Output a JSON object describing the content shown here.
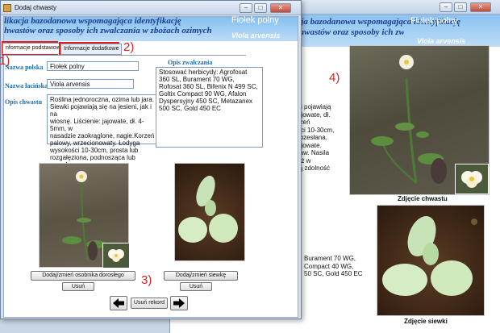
{
  "back_window": {
    "header_line1": "likacja bazodanowa wspomagająca identyfikację",
    "header_line2": "hwastów oraz sposoby ich zwalczania w zbożach ozimych",
    "species_name": "Fiołek polny",
    "latin_name": "Viola arvensis",
    "desc_lines": [
      "ki pojawiają",
      "ajowate, dł.",
      "rzeń",
      "ści 10-30cm,",
      "rozesłana.",
      "ajowate.",
      "raw. Nasila",
      "óż w",
      "ją zdolność"
    ],
    "herb_lines": [
      "Burament 70 WG,",
      "Compact 40 WG,",
      "50 SC, Gold 450 EC"
    ],
    "weed_photo_caption": "Zdjęcie chwastu",
    "seedling_photo_caption": "Zdjęcie  siewki"
  },
  "front_window": {
    "title": "Dodaj chwasty",
    "header_line1": "likacja bazodanowa wspomagająca identyfikację",
    "header_line2": "hwastów oraz sposoby ich zwalczania w zbożach ozimych",
    "species_name": "Fiołek polny",
    "latin_name": "Viola arvensis",
    "tabs": [
      {
        "label": "nformacje podstawowe",
        "active": true
      },
      {
        "label": "Informacje dodatkowe",
        "active": false
      }
    ],
    "labels": {
      "polish": "Nazwa polska",
      "latin": "Nazwa łacińska",
      "description": "Opis chwastu",
      "control": "Opis zwalczania"
    },
    "values": {
      "polish": "Fiołek polny",
      "latin": "Viola arvensis",
      "description_lines": [
        "Roślina jednoroczna, ozima lub jara.",
        "Siewki pojawiają się na jesieni, jak i na",
        "wiosnę. Liścienie: jajowate, dł. 4-5mm, w",
        "nasadzie zaokrąglone, nagie.Korzeń",
        "palowy, wrzecionowaty. Łodyga",
        "wysokości 10-30cm, prosta lub",
        "rozgałęziona, podnosząca lub rozesłana."
      ],
      "control_lines": [
        "Stosować herbicydy: Agrofosat",
        "360 SL, Burament 70 WG,",
        "Rofosat 360 SL, Bifenix N 499 SC,",
        "Goltix Compact 90 WG, Afalon",
        "Dyspersyjny 450 SC, Metazanex",
        "500 SC, Gold 450 EC"
      ]
    },
    "buttons": {
      "add_adult": "Dodaj/zmień osobnika dorosłego",
      "delete_adult": "Usuń",
      "add_seedling": "Dodaj/zmień siewkę",
      "delete_seedling": "Usuń",
      "delete_record": "Usuń rekord"
    }
  },
  "annotations": [
    "1)",
    "2)",
    "3)",
    "4)"
  ],
  "colors": {
    "header_blue": "#8cc2f0",
    "header_text": "#1a3f8f",
    "label_blue": "#1d6aa8",
    "annotation_red": "#e02020"
  },
  "icons": [
    "minimize-icon",
    "maximize-icon",
    "close-icon",
    "arrow-left-icon",
    "arrow-right-icon"
  ]
}
